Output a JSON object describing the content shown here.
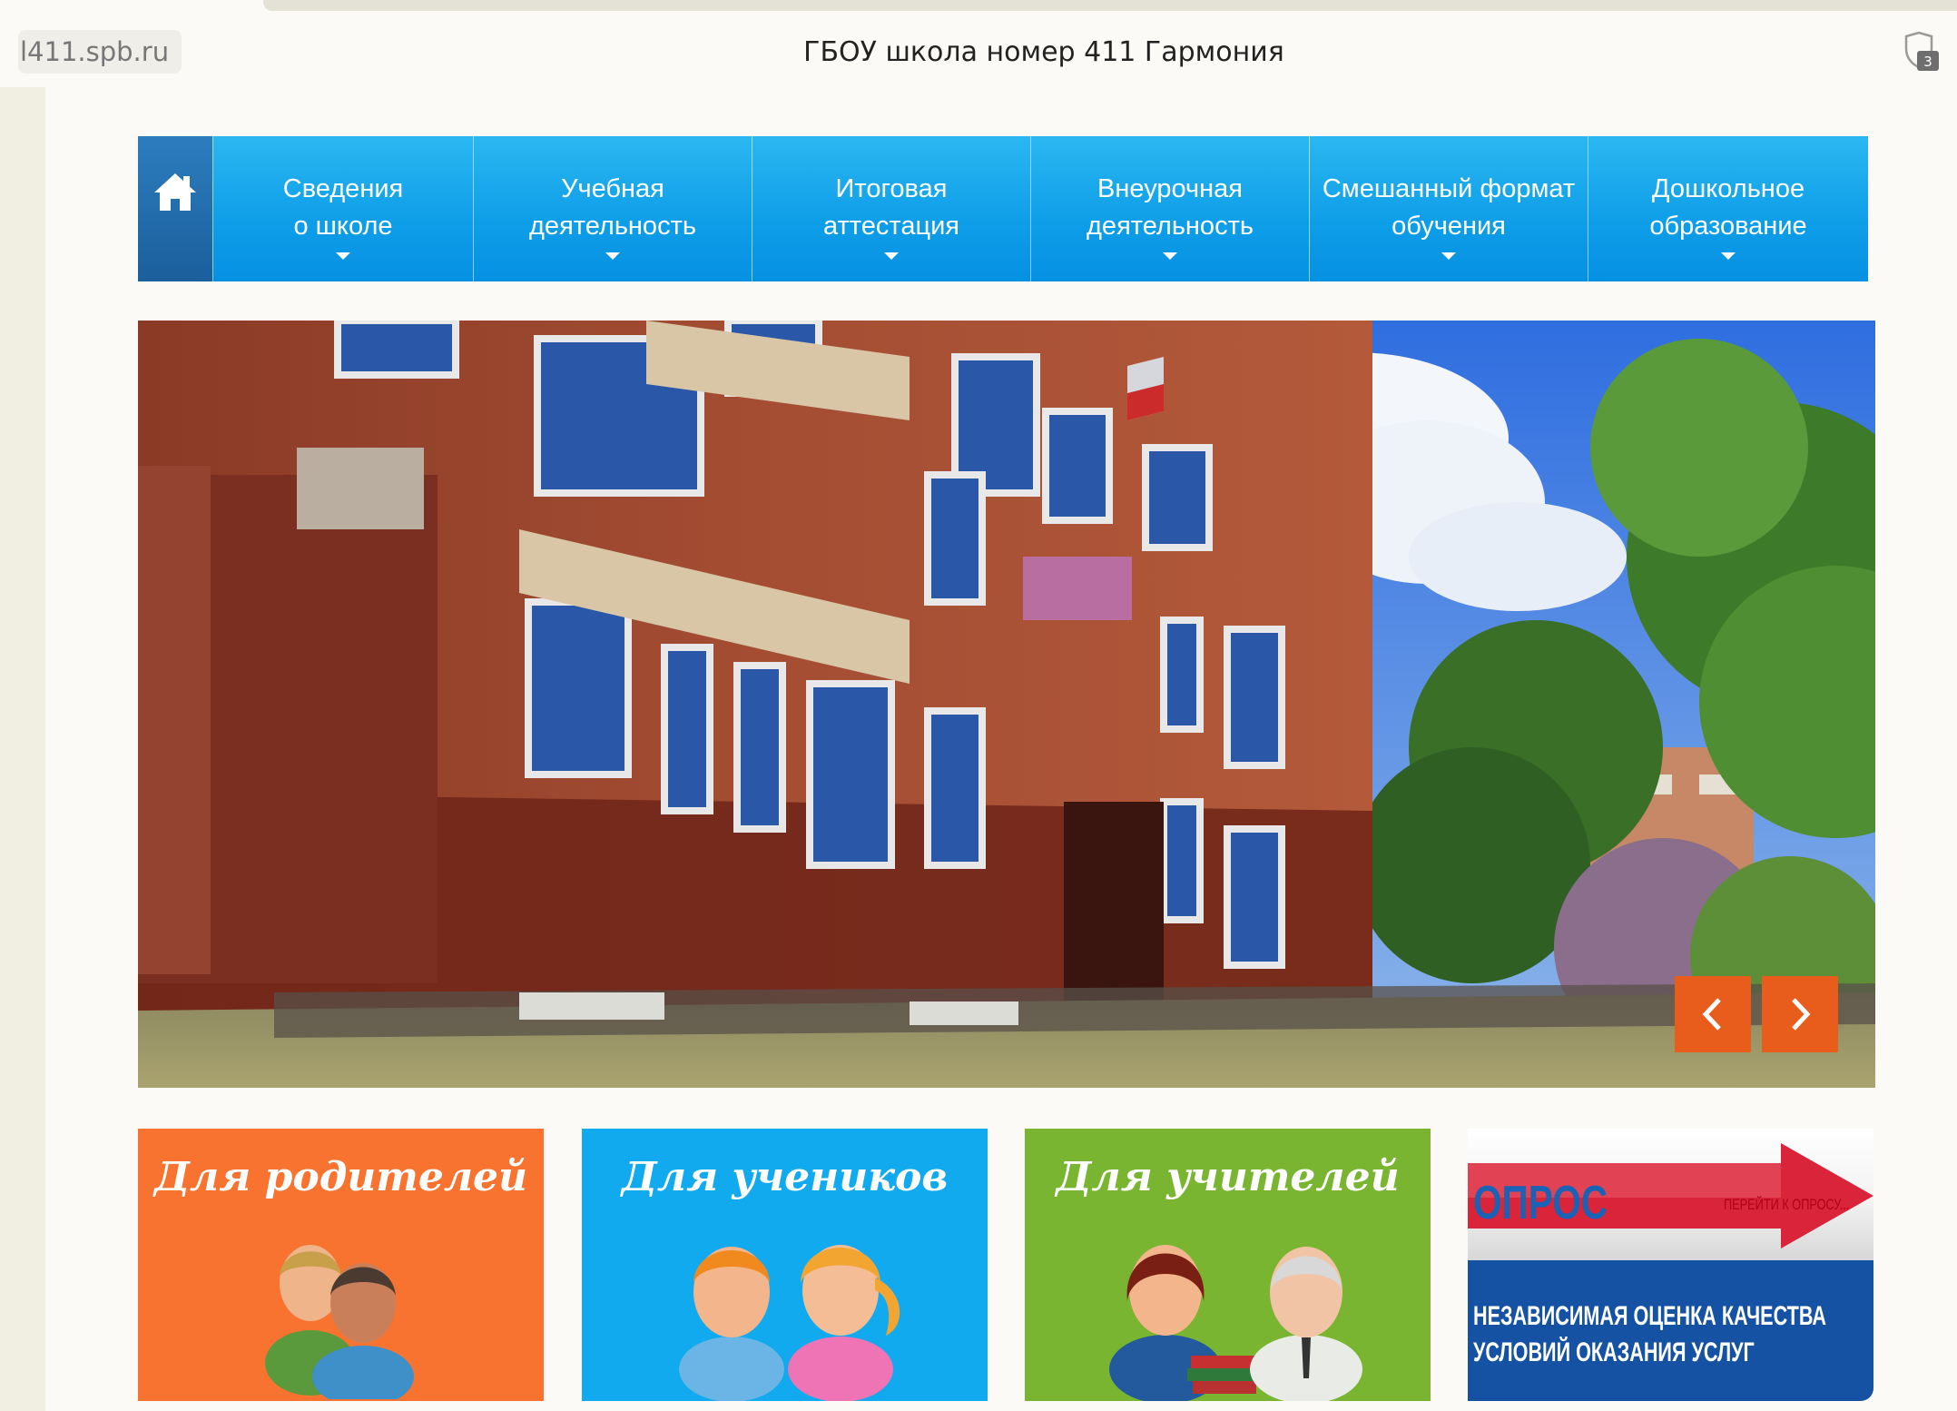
{
  "browser": {
    "url": "l411.spb.ru",
    "title": "ГБОУ школа номер 411 Гармония",
    "shield_count": "3"
  },
  "nav": {
    "home_icon": "home-icon",
    "items": [
      {
        "line1": "Сведения",
        "line2": "о школе"
      },
      {
        "line1": "Учебная",
        "line2": "деятельность"
      },
      {
        "line1": "Итоговая",
        "line2": "аттестация"
      },
      {
        "line1": "Внеурочная",
        "line2": "деятельность"
      },
      {
        "line1": "Смешанный формат",
        "line2": "обучения"
      },
      {
        "line1": "Дошкольное",
        "line2": "образование"
      }
    ]
  },
  "slider": {
    "prev_icon": "chevron-left-icon",
    "next_icon": "chevron-right-icon"
  },
  "tiles": {
    "parents": "Для родителей",
    "students": "Для учеников",
    "teachers": "Для учителей"
  },
  "survey": {
    "label": "ОПРОС",
    "go_link": "ПЕРЕЙТИ К ОПРОСУ...",
    "line1": "НЕЗАВИСИМАЯ ОЦЕНКА КАЧЕСТВА",
    "line2": "УСЛОВИЙ ОКАЗАНИЯ УСЛУГ"
  },
  "colors": {
    "nav_blue": "#0e9ee8",
    "arrow_orange": "#e85d1c",
    "tile_parents": "#f97330",
    "tile_students": "#12aaef",
    "tile_teachers": "#79b531",
    "survey_blue": "#1552a3"
  }
}
